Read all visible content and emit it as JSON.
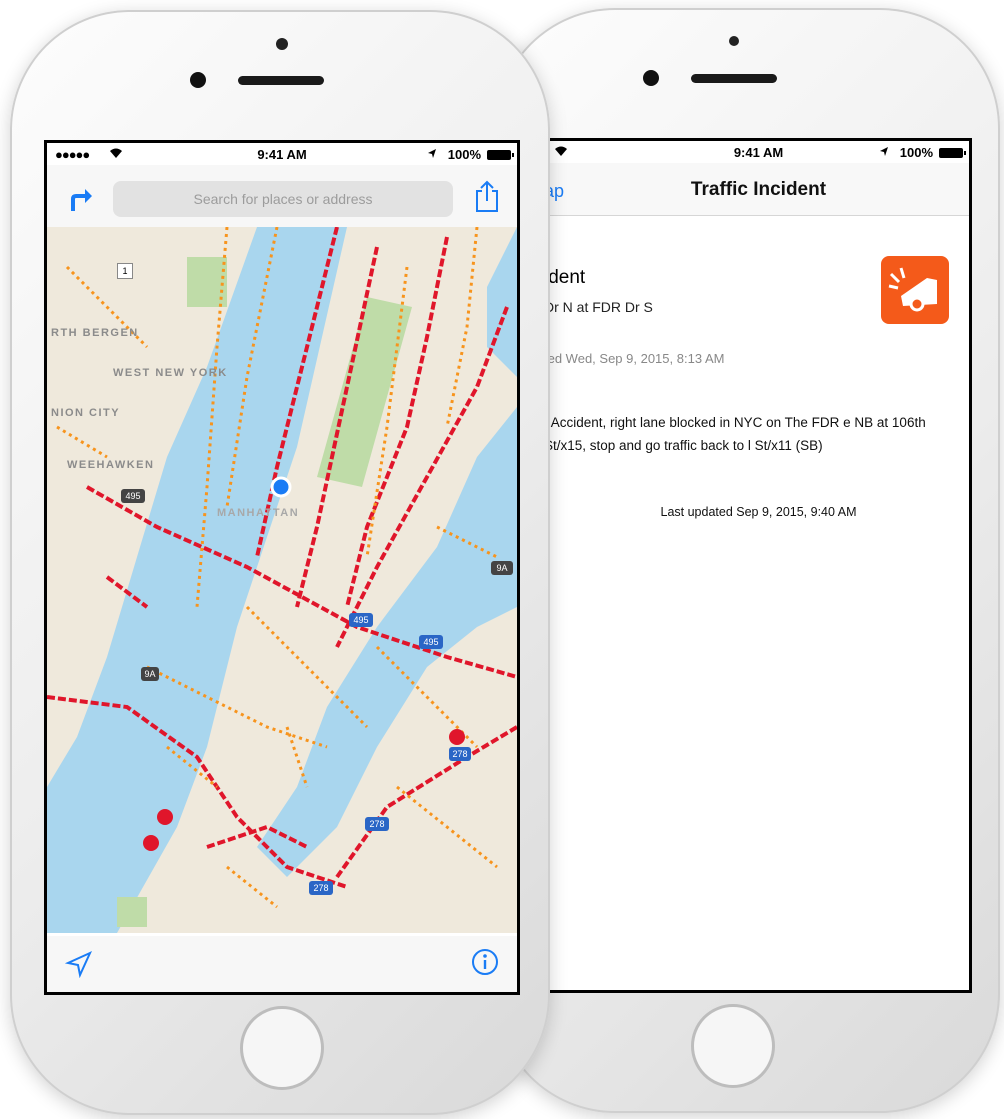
{
  "right_phone": {
    "status_bar": {
      "time": "9:41 AM",
      "battery": "100%"
    },
    "nav": {
      "back_label": "ap",
      "title": "Traffic Incident"
    },
    "incident": {
      "title": "ident",
      "road": "Dr N at FDR Dr S",
      "reported": "ted Wed, Sep 9, 2015, 8:13 AM",
      "description": ": Accident, right lane blocked in NYC on The FDR e NB at 106th St/x15, stop and go traffic back to l St/x11 (SB)",
      "last_updated": "Last updated Sep 9, 2015, 9:40 AM",
      "badge_icon": "car-crash-icon",
      "badge_color": "#f45a1a"
    }
  },
  "left_phone": {
    "status_bar": {
      "signal": "●●●●● ",
      "time": "9:41 AM",
      "battery": "100%"
    },
    "search": {
      "placeholder": "Search for places or address"
    },
    "map": {
      "labels": [
        "RTH BERGEN",
        "WEST NEW YORK",
        "NION CITY",
        "WEEHAWKEN",
        "MANHATTAN"
      ],
      "shields": [
        "1",
        "495",
        "495",
        "495",
        "9A",
        "278",
        "278",
        "9A",
        "278"
      ],
      "water_color": "#a9d6ee",
      "land_color": "#efe9dc",
      "park_color": "#bfdca8",
      "heavy_traffic_color": "#e0162b",
      "moderate_traffic_color": "#f7941d"
    },
    "accent_color": "#1a7cf5"
  }
}
